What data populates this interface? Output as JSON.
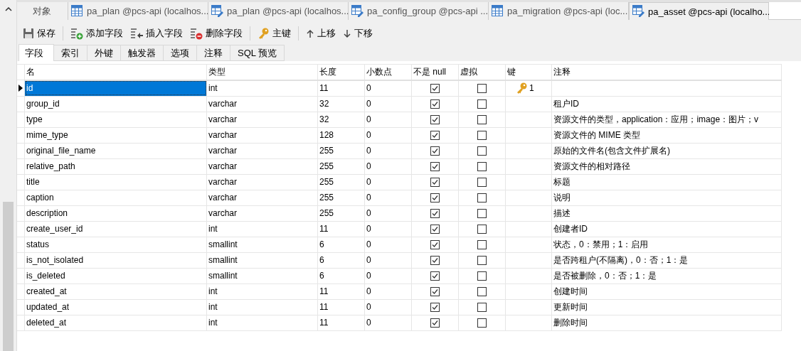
{
  "doc_tabs": [
    {
      "label": "对象",
      "kind": "objects",
      "selected": false
    },
    {
      "label": "pa_plan @pcs-api (localhos...",
      "kind": "table",
      "selected": false
    },
    {
      "label": "pa_plan @pcs-api (localhos...",
      "kind": "design",
      "selected": false
    },
    {
      "label": "pa_config_group @pcs-api ...",
      "kind": "design",
      "selected": false
    },
    {
      "label": "pa_migration @pcs-api (loc...",
      "kind": "table",
      "selected": false
    },
    {
      "label": "pa_asset @pcs-api (localho...",
      "kind": "design",
      "selected": true
    }
  ],
  "toolbar": [
    {
      "label": "保存",
      "kind": "save"
    },
    {
      "label": "添加字段",
      "kind": "add"
    },
    {
      "label": "插入字段",
      "kind": "insert"
    },
    {
      "label": "删除字段",
      "kind": "delete"
    },
    {
      "label": "主键",
      "kind": "key"
    },
    {
      "label": "上移",
      "kind": "up"
    },
    {
      "label": "下移",
      "kind": "down"
    }
  ],
  "sub_tabs": [
    {
      "label": "字段",
      "selected": true
    },
    {
      "label": "索引",
      "selected": false
    },
    {
      "label": "外键",
      "selected": false
    },
    {
      "label": "触发器",
      "selected": false
    },
    {
      "label": "选项",
      "selected": false
    },
    {
      "label": "注释",
      "selected": false
    },
    {
      "label": "SQL 预览",
      "selected": false
    }
  ],
  "table": {
    "columns": [
      "名",
      "类型",
      "长度",
      "小数点",
      "不是 null",
      "虚拟",
      "键",
      "注释"
    ],
    "rows": [
      {
        "name": "id",
        "type": "int",
        "length": "11",
        "decimals": "0",
        "not_null": true,
        "virtual": false,
        "key": "1",
        "comment": "",
        "selected": true
      },
      {
        "name": "group_id",
        "type": "varchar",
        "length": "32",
        "decimals": "0",
        "not_null": true,
        "virtual": false,
        "comment": "租户ID",
        "selected": false
      },
      {
        "name": "type",
        "type": "varchar",
        "length": "32",
        "decimals": "0",
        "not_null": true,
        "virtual": false,
        "comment": "资源文件的类型，application：应用；image：图片；v",
        "selected": false
      },
      {
        "name": "mime_type",
        "type": "varchar",
        "length": "128",
        "decimals": "0",
        "not_null": true,
        "virtual": false,
        "comment": "资源文件的 MIME 类型",
        "selected": false
      },
      {
        "name": "original_file_name",
        "type": "varchar",
        "length": "255",
        "decimals": "0",
        "not_null": true,
        "virtual": false,
        "comment": "原始的文件名(包含文件扩展名)",
        "selected": false
      },
      {
        "name": "relative_path",
        "type": "varchar",
        "length": "255",
        "decimals": "0",
        "not_null": true,
        "virtual": false,
        "comment": "资源文件的相对路径",
        "selected": false
      },
      {
        "name": "title",
        "type": "varchar",
        "length": "255",
        "decimals": "0",
        "not_null": true,
        "virtual": false,
        "comment": "标题",
        "selected": false
      },
      {
        "name": "caption",
        "type": "varchar",
        "length": "255",
        "decimals": "0",
        "not_null": true,
        "virtual": false,
        "comment": "说明",
        "selected": false
      },
      {
        "name": "description",
        "type": "varchar",
        "length": "255",
        "decimals": "0",
        "not_null": true,
        "virtual": false,
        "comment": "描述",
        "selected": false
      },
      {
        "name": "create_user_id",
        "type": "int",
        "length": "11",
        "decimals": "0",
        "not_null": true,
        "virtual": false,
        "comment": "创建者ID",
        "selected": false
      },
      {
        "name": "status",
        "type": "smallint",
        "length": "6",
        "decimals": "0",
        "not_null": true,
        "virtual": false,
        "comment": "状态，0：禁用；1：启用",
        "selected": false
      },
      {
        "name": "is_not_isolated",
        "type": "smallint",
        "length": "6",
        "decimals": "0",
        "not_null": true,
        "virtual": false,
        "comment": "是否跨租户(不隔离)，0：否；1：是",
        "selected": false
      },
      {
        "name": "is_deleted",
        "type": "smallint",
        "length": "6",
        "decimals": "0",
        "not_null": true,
        "virtual": false,
        "comment": "是否被删除，0：否；1：是",
        "selected": false
      },
      {
        "name": "created_at",
        "type": "int",
        "length": "11",
        "decimals": "0",
        "not_null": true,
        "virtual": false,
        "comment": "创建时间",
        "selected": false
      },
      {
        "name": "updated_at",
        "type": "int",
        "length": "11",
        "decimals": "0",
        "not_null": true,
        "virtual": false,
        "comment": "更新时间",
        "selected": false
      },
      {
        "name": "deleted_at",
        "type": "int",
        "length": "11",
        "decimals": "0",
        "not_null": true,
        "virtual": false,
        "comment": "删除时间",
        "selected": false
      }
    ]
  }
}
